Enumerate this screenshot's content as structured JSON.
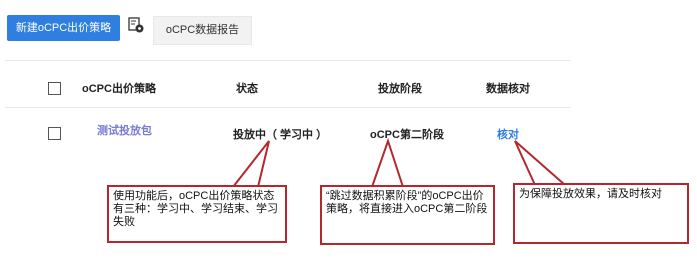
{
  "toolbar": {
    "new_button": "新建oCPC出价策略",
    "report_button": "oCPC数据报告",
    "icon": "report-settings-icon"
  },
  "table": {
    "headers": {
      "strategy": "oCPC出价策略",
      "status": "状态",
      "stage": "投放阶段",
      "verify": "数据核对"
    },
    "rows": [
      {
        "strategy": "测试投放包",
        "status": "投放中（  学习中  ）",
        "stage": "oCPC第二阶段",
        "verify": "核对"
      }
    ]
  },
  "callouts": [
    {
      "text": "使用功能后，oCPC出价策略状态有三种：学习中、学习结束、学习失败"
    },
    {
      "text": "“跳过数据积累阶段”的oCPC出价策略，将直接进入oCPC第二阶段"
    },
    {
      "text": "为保障投放效果，请及时核对"
    }
  ],
  "colors": {
    "primary": "#2e7fe0",
    "callout_border": "#b3282d",
    "link": "#7a7bd6"
  }
}
